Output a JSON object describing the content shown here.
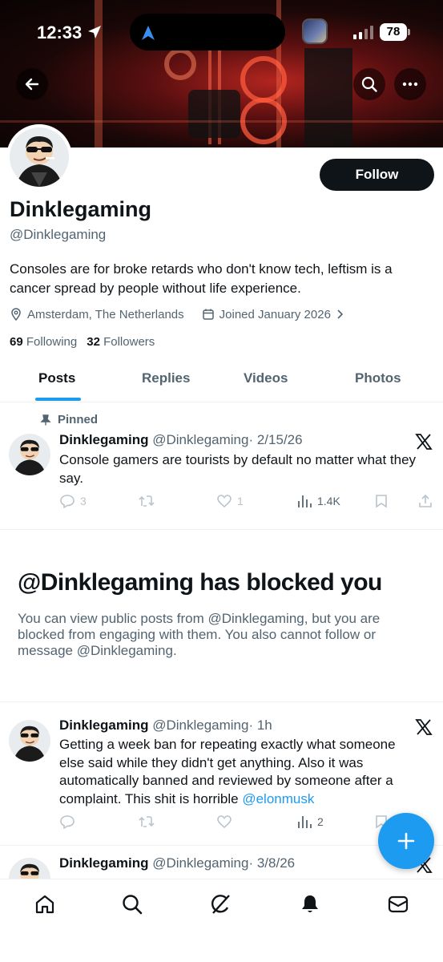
{
  "status_bar": {
    "time": "12:33",
    "battery": "78"
  },
  "profile": {
    "display_name": "Dinklegaming",
    "handle": "@Dinklegaming",
    "bio": "Consoles are for broke retards who don't know tech, leftism is a cancer spread by people without life experience.",
    "location": "Amsterdam, The Netherlands",
    "joined": "Joined January 2026",
    "following_count": "69",
    "following_label": "Following",
    "followers_count": "32",
    "followers_label": "Followers",
    "follow_label": "Follow"
  },
  "tabs": [
    {
      "label": "Posts",
      "active": true
    },
    {
      "label": "Replies",
      "active": false
    },
    {
      "label": "Videos",
      "active": false
    },
    {
      "label": "Photos",
      "active": false
    }
  ],
  "posts": [
    {
      "pinned_label": "Pinned",
      "name": "Dinklegaming",
      "handle": "@Dinklegaming",
      "time": "· 2/15/26",
      "text": "Console gamers are tourists by default no matter what they say.",
      "replies": "3",
      "reposts": "",
      "likes": "1",
      "views": "1.4K"
    },
    {
      "name": "Dinklegaming",
      "handle": "@Dinklegaming",
      "time": "· 1h",
      "text": "Getting a week ban for repeating exactly what someone else said while they didn't get anything. Also it was automatically banned and reviewed by someone after a complaint. This shit is horrible ",
      "mention": "@elonmusk",
      "views": "2"
    },
    {
      "name": "Dinklegaming",
      "handle": "@Dinklegaming",
      "time": "· 3/8/26"
    }
  ],
  "blocked": {
    "title": "@Dinklegaming has blocked you",
    "description": "You can view public posts from @Dinklegaming, but you are blocked from engaging with them. You also cannot follow or message @Dinklegaming."
  },
  "icons": {
    "back": "arrow-left-icon",
    "search": "search-icon",
    "more": "more-dots-icon",
    "compose": "plus-icon",
    "nav": [
      "home-icon",
      "search-icon",
      "grok-icon",
      "bell-icon",
      "mail-icon"
    ]
  },
  "colors": {
    "accent": "#1d9bf0",
    "text": "#0f1419",
    "muted": "#536471"
  }
}
